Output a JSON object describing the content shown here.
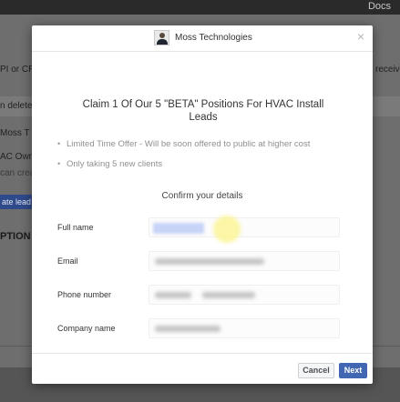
{
  "background": {
    "docs_link": "Docs",
    "snippet_api": "PI or CR",
    "snippet_receive": "receive c",
    "snippet_deleted": "n deleted",
    "snippet_page": "Moss T",
    "snippet_owner": "AC Owne",
    "snippet_create": "can creat",
    "create_button_fragment": "ate lead",
    "section_heading_fragment": "PTION F"
  },
  "modal": {
    "brand_name": "Moss Technologies",
    "close_symbol": "×",
    "title": "Claim 1 Of Our 5 \"BETA\" Positions For HVAC Install Leads",
    "bullets": [
      "Limited Time Offer - Will be soon offered to public at higher cost",
      "Only taking 5 new clients"
    ],
    "bullet_symbol": "•",
    "confirm_label": "Confirm your details",
    "fields": [
      {
        "label": "Full name"
      },
      {
        "label": "Email"
      },
      {
        "label": "Phone number"
      },
      {
        "label": "Company name"
      }
    ],
    "cancel_label": "Cancel",
    "next_label": "Next"
  },
  "colors": {
    "accent": "#4267b2",
    "overlay": "#6e6e6e",
    "pointer_highlight": "#fcf496"
  }
}
